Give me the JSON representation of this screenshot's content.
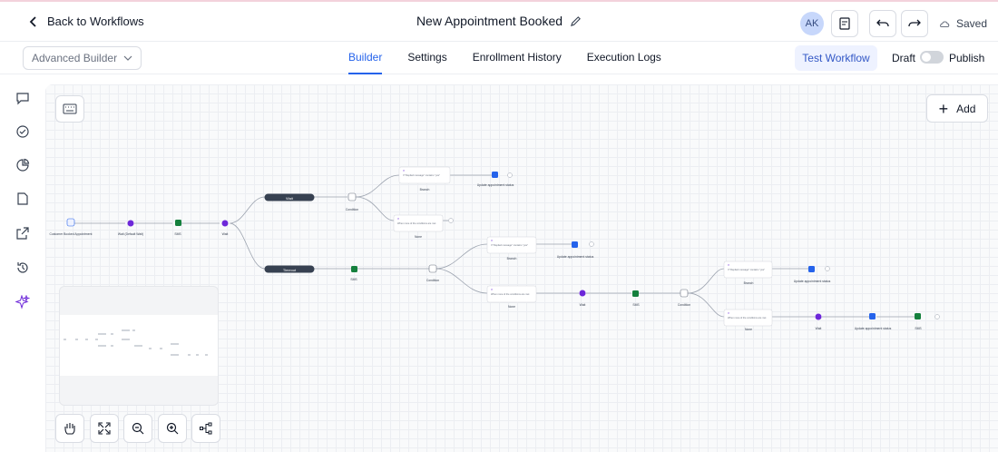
{
  "header": {
    "back_label": "Back to Workflows",
    "workflow_title": "New Appointment Booked",
    "avatar_initials": "AK",
    "saved_label": "Saved"
  },
  "subbar": {
    "builder_mode": "Advanced Builder",
    "tabs": [
      {
        "label": "Builder",
        "active": true
      },
      {
        "label": "Settings",
        "active": false
      },
      {
        "label": "Enrollment History",
        "active": false
      },
      {
        "label": "Execution Logs",
        "active": false
      }
    ],
    "test_workflow": "Test Workflow",
    "draft": "Draft",
    "publish": "Publish",
    "publish_toggle_on": false
  },
  "canvas": {
    "add_label": "Add"
  },
  "flow": {
    "wait": "Wait",
    "timeout": "Timeout",
    "trigger": "Customer Booked Appointment",
    "wait_default": "Wait (Default Wait)",
    "sms": "SMS",
    "wait_step": "Wait",
    "condition": "Condition",
    "branch": "Branch",
    "none": "None",
    "update_status": "Update appointment status",
    "if_note": "If",
    "branch_text": "If \"Replied message\" contains \"yes\"",
    "none_text": "When none of the conditions are met"
  },
  "colors": {
    "accent": "#2563eb",
    "purple": "#6d28d9",
    "green": "#15803d",
    "blue": "#2563eb"
  }
}
